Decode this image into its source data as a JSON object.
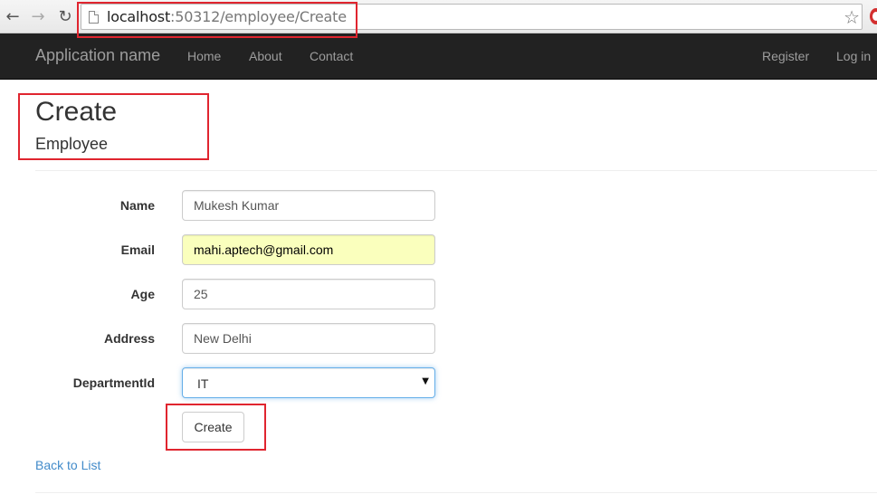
{
  "browser": {
    "url_host": "localhost",
    "url_rest": ":50312/employee/Create",
    "back_icon": "arrow-left-icon",
    "forward_icon": "arrow-right-icon",
    "reload_icon": "reload-icon",
    "bookmark_icon": "star-icon"
  },
  "navbar": {
    "brand": "Application name",
    "links": [
      "Home",
      "About",
      "Contact"
    ],
    "right_links": [
      "Register",
      "Log in"
    ]
  },
  "page": {
    "title": "Create",
    "subtitle": "Employee"
  },
  "form": {
    "fields": [
      {
        "label": "Name",
        "value": "Mukesh Kumar"
      },
      {
        "label": "Email",
        "value": "mahi.aptech@gmail.com"
      },
      {
        "label": "Age",
        "value": "25"
      },
      {
        "label": "Address",
        "value": "New Delhi"
      },
      {
        "label": "DepartmentId",
        "value": "IT"
      }
    ],
    "submit_label": "Create",
    "back_link": "Back to List"
  },
  "colors": {
    "annotation": "#e0252f",
    "navbar_bg": "#222222",
    "link": "#428bca",
    "autofill": "#faffbd"
  }
}
